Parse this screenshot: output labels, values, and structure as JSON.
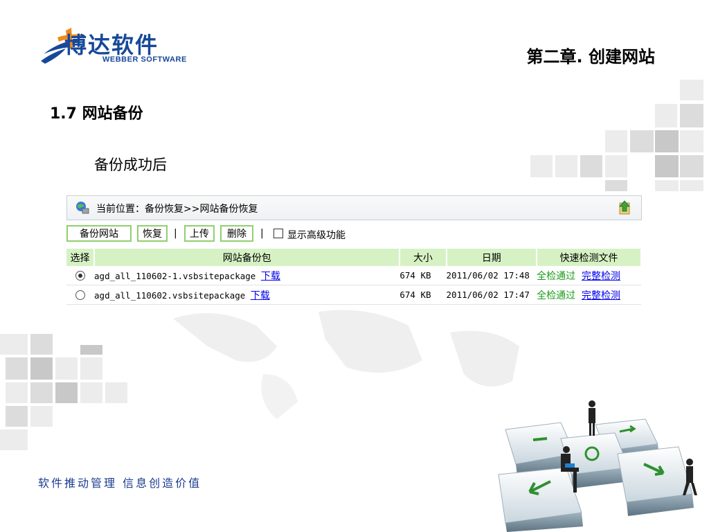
{
  "header": {
    "logo_cn": "博达软件",
    "logo_en": "WEBBER SOFTWARE",
    "chapter_title": "第二章. 创建网站"
  },
  "section_title": "1.7 网站备份",
  "subtitle": "备份成功后",
  "app": {
    "breadcrumb": "当前位置：备份恢复>>网站备份恢复",
    "toolbar": {
      "backup_label": "备份网站",
      "restore_label": "恢复",
      "sep": "|",
      "upload_label": "上传",
      "delete_label": "删除",
      "advanced_label": "显示高级功能"
    },
    "table": {
      "headers": [
        "选择",
        "网站备份包",
        "大小",
        "日期",
        "快速检测文件"
      ],
      "rows": [
        {
          "selected": true,
          "file": "agd_all_110602-1.vsbsitepackage",
          "download": "下载",
          "size": "674 KB",
          "date": "2011/06/02 17:48",
          "check": "全检通过",
          "full_check": "完整检测"
        },
        {
          "selected": false,
          "file": "agd_all_110602.vsbsitepackage",
          "download": "下载",
          "size": "674 KB",
          "date": "2011/06/02 17:47",
          "check": "全检通过",
          "full_check": "完整检测"
        }
      ]
    }
  },
  "footer": {
    "slogan": "软件推动管理  信息创造价值"
  },
  "colors": {
    "brand_blue": "#16489a",
    "accent_orange": "#f08a1c",
    "header_green": "#d6f2c4",
    "button_border_green": "#8fd06e",
    "pass_green": "#1a9b1a",
    "link_blue": "#0000ee"
  }
}
